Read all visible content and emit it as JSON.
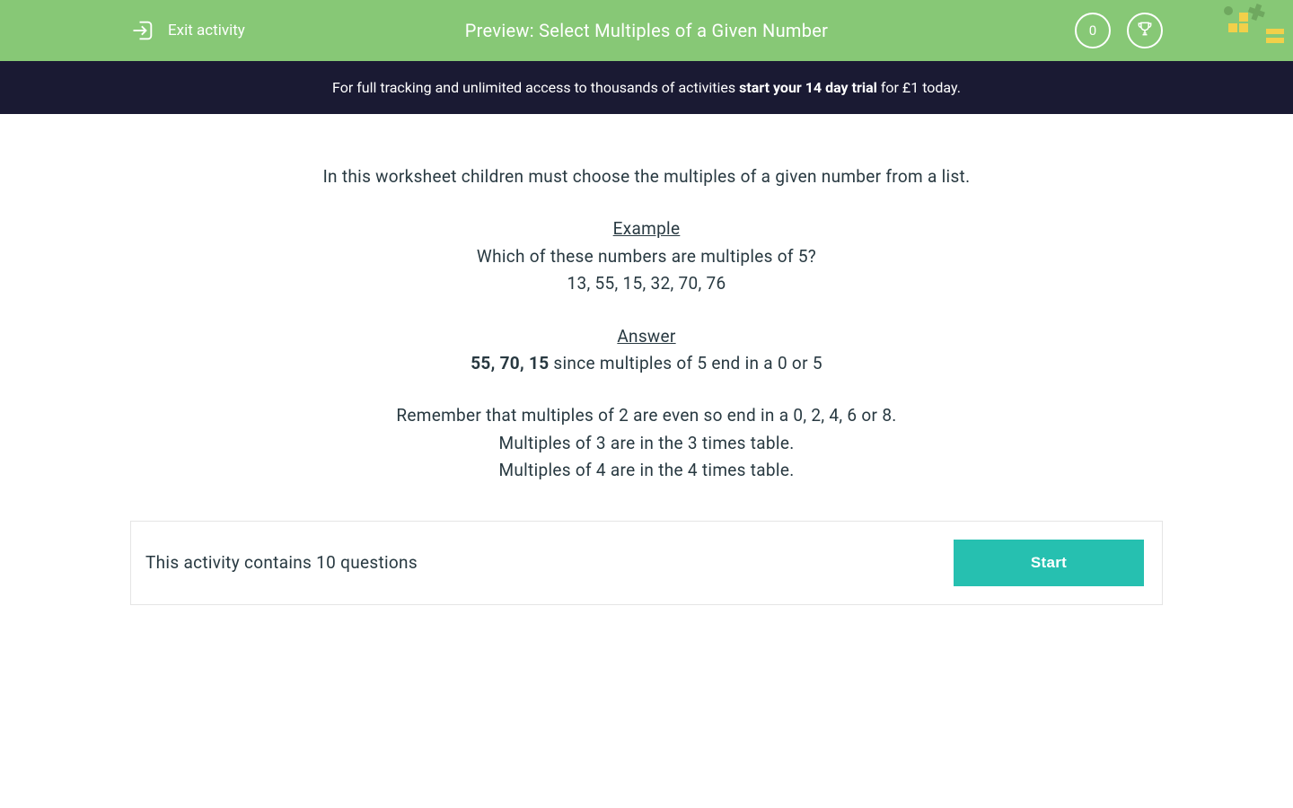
{
  "header": {
    "exit_label": "Exit activity",
    "title": "Preview: Select Multiples of a Given Number",
    "points": "0"
  },
  "banner": {
    "prefix": "For full tracking and unlimited access to thousands of activities ",
    "bold": "start your 14 day trial",
    "suffix": " for £1 today."
  },
  "content": {
    "intro": "In this worksheet children must choose the multiples of a given number from a list.",
    "example_label": "Example",
    "example_question": "Which of these numbers are multiples of 5?",
    "example_numbers": "13, 55, 15, 32, 70, 76",
    "answer_label": "Answer  ",
    "answer_bold": "55, 70, 15",
    "answer_rest": "  since multiples of 5 end in a 0 or 5",
    "tip1": "Remember that multiples of 2 are even so end in a 0, 2, 4, 6 or 8.",
    "tip2": "Multiples of 3 are in the 3 times table.",
    "tip3": "Multiples of 4 are in the 4 times table."
  },
  "activity_bar": {
    "text": "This activity contains 10 questions",
    "button": "Start"
  }
}
